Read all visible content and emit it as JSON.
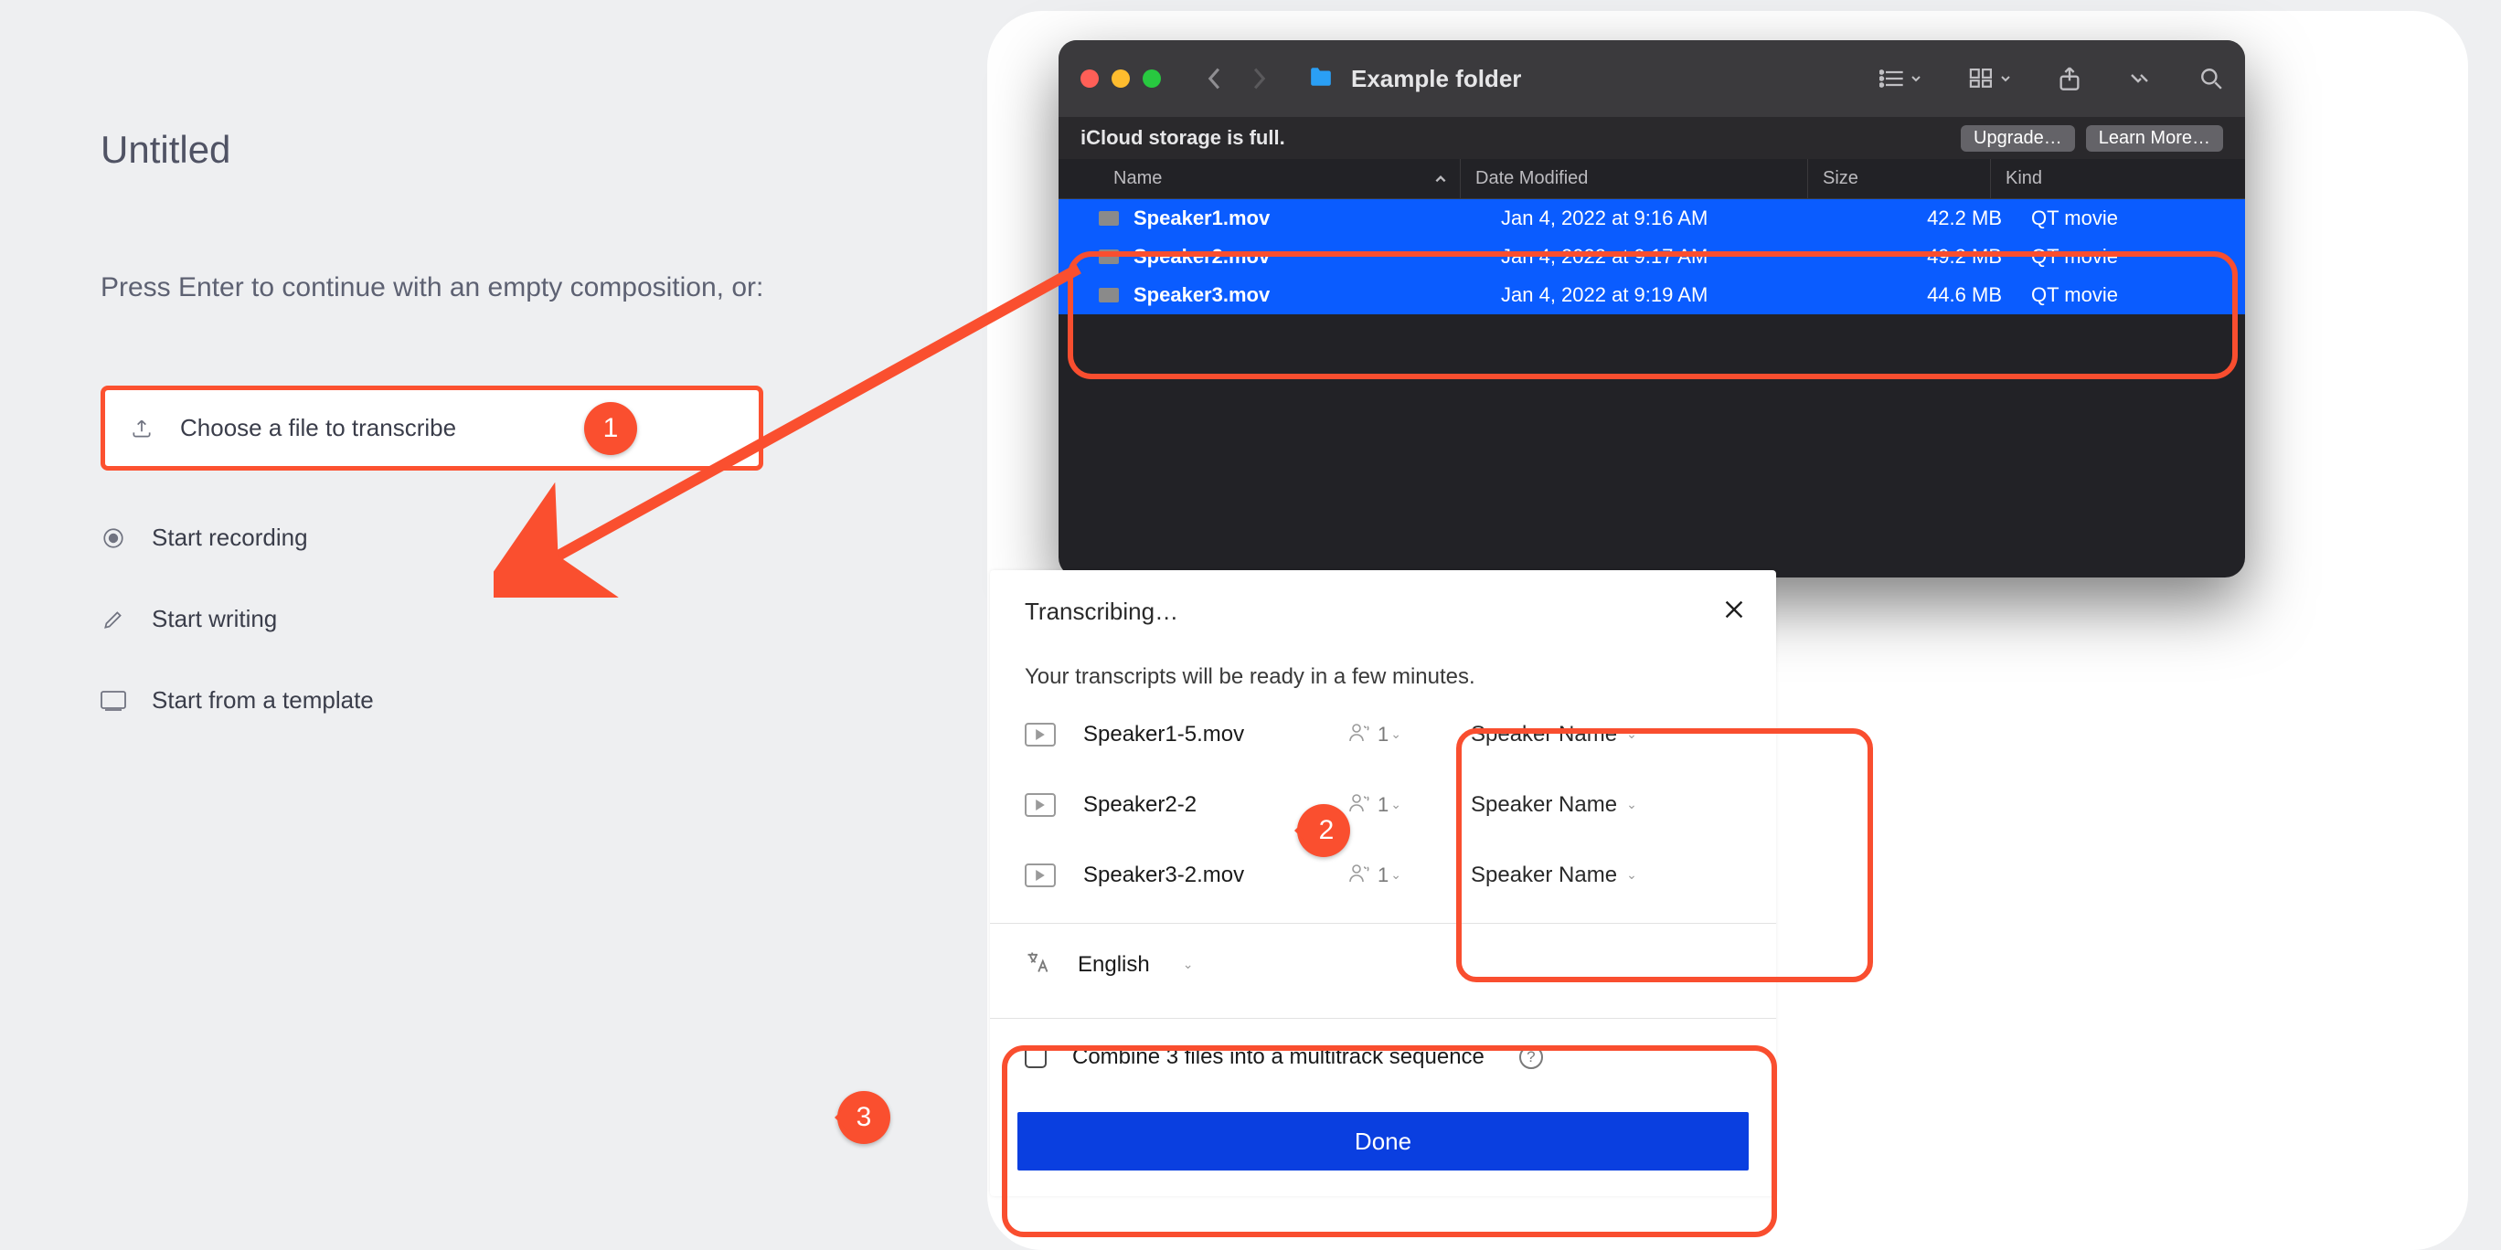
{
  "doc": {
    "title": "Untitled",
    "subtitle": "Press Enter to continue with an empty composition, or:",
    "options": {
      "transcribe": "Choose a file to transcribe",
      "record": "Start recording",
      "write": "Start writing",
      "template": "Start from a template"
    }
  },
  "finder": {
    "title": "Example folder",
    "alert": "iCloud storage is full.",
    "upgrade": "Upgrade…",
    "learn": "Learn More…",
    "columns": {
      "name": "Name",
      "date": "Date Modified",
      "size": "Size",
      "kind": "Kind"
    },
    "files": [
      {
        "name": "Speaker1.mov",
        "date": "Jan 4, 2022 at 9:16 AM",
        "size": "42.2 MB",
        "kind": "QT movie"
      },
      {
        "name": "Speaker2.mov",
        "date": "Jan 4, 2022 at 9:17 AM",
        "size": "49.2 MB",
        "kind": "QT movie"
      },
      {
        "name": "Speaker3.mov",
        "date": "Jan 4, 2022 at 9:19 AM",
        "size": "44.6 MB",
        "kind": "QT movie"
      }
    ]
  },
  "modal": {
    "title": "Transcribing…",
    "subtitle": "Your transcripts will be ready in a few minutes.",
    "files": [
      {
        "name": "Speaker1-5.mov",
        "count": "1",
        "speaker": "Speaker Name"
      },
      {
        "name": "Speaker2-2",
        "count": "1",
        "speaker": "Speaker Name"
      },
      {
        "name": "Speaker3-2.mov",
        "count": "1",
        "speaker": "Speaker Name"
      }
    ],
    "language": "English",
    "combine": "Combine 3 files into a multitrack sequence",
    "done": "Done"
  },
  "badges": {
    "b1": "1",
    "b2": "2",
    "b3": "3"
  }
}
